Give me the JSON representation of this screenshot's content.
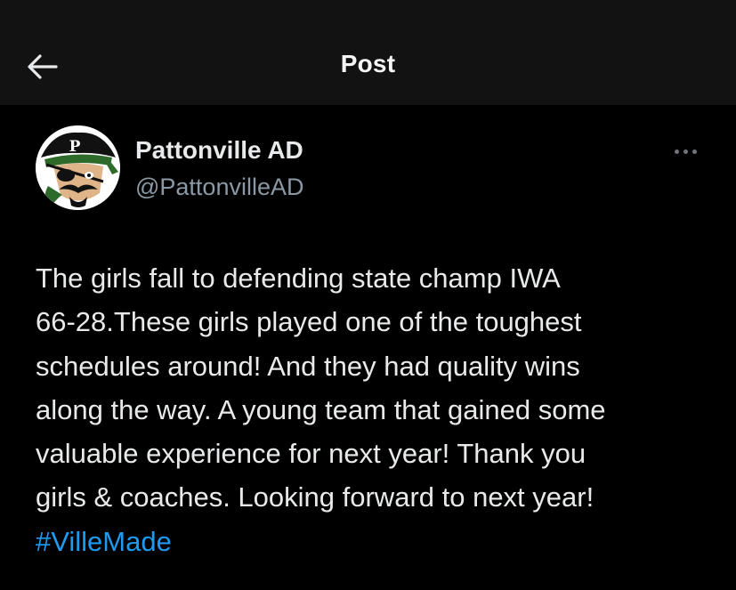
{
  "header": {
    "title": "Post",
    "back_icon": "arrow-left-icon"
  },
  "post": {
    "author": {
      "display_name": "Pattonville AD",
      "handle": "@PattonvilleAD",
      "avatar_icon": "pirate-mascot-avatar",
      "avatar_letter": "P"
    },
    "more_icon": "more-horizontal-icon",
    "body_lines": [
      "The girls fall to defending state champ IWA",
      "66-28.These girls played one of the toughest",
      "schedules around! And they had quality wins",
      "along the way. A young team that gained some",
      "valuable experience for next year! Thank you",
      "girls & coaches. Looking forward to next year!"
    ],
    "hashtag": "#VilleMade"
  },
  "colors": {
    "background": "#000000",
    "header_background": "#121212",
    "text": "#e7e9ea",
    "secondary_text": "#8b98a5",
    "link": "#1d9bf0"
  }
}
